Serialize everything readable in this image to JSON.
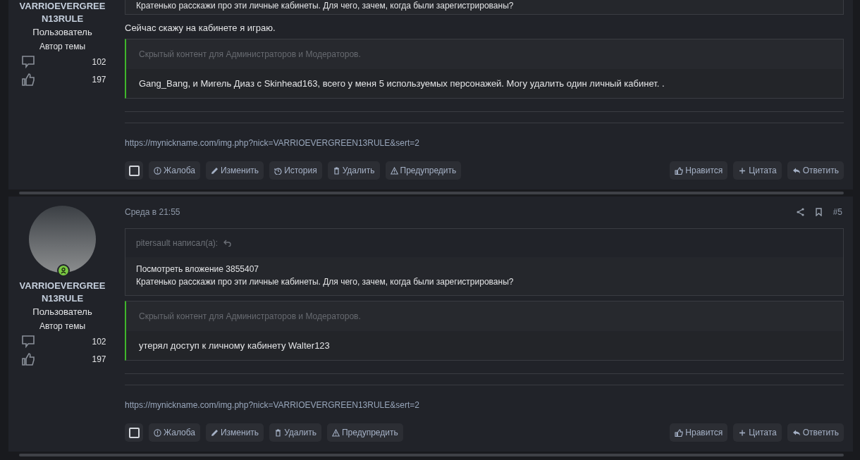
{
  "posts": [
    {
      "author": {
        "name": "VARRIOEVERGREE N13RULE",
        "role": "Пользователь",
        "badge": "Автор темы",
        "stats": [
          {
            "kind": "messages",
            "value": "102"
          },
          {
            "kind": "likes",
            "value": "197"
          }
        ]
      },
      "quote_tail": "Кратенько расскажи про эти личные кабинеты. Для чего, зачем, когда были зарегистрированы?",
      "text": "Сейчас скажу на кабинете я играю.",
      "hidden": {
        "header": "Скрытый контент для Администраторов и Модераторов.",
        "body": "Gang_Bang, и Мигель Диаз с Skinhead163, всего у меня 5 используемых персонажей. Могу удалить один личный кабинет. ."
      },
      "signature": "https://mynickname.com/img.php?nick=VARRIOEVERGREEN13RULE&sert=2",
      "actions_left": [
        {
          "kind": "select",
          "checked": false
        },
        {
          "kind": "report",
          "label": "Жалоба"
        },
        {
          "kind": "edit",
          "label": "Изменить"
        },
        {
          "kind": "history",
          "label": "История"
        },
        {
          "kind": "delete",
          "label": "Удалить"
        },
        {
          "kind": "warn",
          "label": "Предупредить"
        }
      ],
      "actions_right": [
        {
          "kind": "like",
          "label": "Нравится"
        },
        {
          "kind": "quote",
          "label": "Цитата"
        },
        {
          "kind": "reply",
          "label": "Ответить"
        }
      ]
    },
    {
      "author": {
        "name": "VARRIOEVERGREE N13RULE",
        "role": "Пользователь",
        "badge": "Автор темы",
        "avatar": true,
        "online": true,
        "stats": [
          {
            "kind": "messages",
            "value": "102"
          },
          {
            "kind": "likes",
            "value": "197"
          }
        ]
      },
      "date": "Среда в 21:55",
      "number": "#5",
      "quote": {
        "author": "pitersault написал(а):",
        "lines": [
          "Посмотреть вложение 3855407",
          "Кратенько расскажи про эти личные кабинеты. Для чего, зачем, когда были зарегистрированы?"
        ]
      },
      "hidden": {
        "header": "Скрытый контент для Администраторов и Модераторов.",
        "body": "утерял доступ к личному кабинету Walter123"
      },
      "signature": "https://mynickname.com/img.php?nick=VARRIOEVERGREEN13RULE&sert=2",
      "actions_left": [
        {
          "kind": "select",
          "checked": false
        },
        {
          "kind": "report",
          "label": "Жалоба"
        },
        {
          "kind": "edit",
          "label": "Изменить"
        },
        {
          "kind": "delete",
          "label": "Удалить"
        },
        {
          "kind": "warn",
          "label": "Предупредить"
        }
      ],
      "actions_right": [
        {
          "kind": "like",
          "label": "Нравится"
        },
        {
          "kind": "quote",
          "label": "Цитата"
        },
        {
          "kind": "reply",
          "label": "Ответить"
        }
      ]
    }
  ]
}
